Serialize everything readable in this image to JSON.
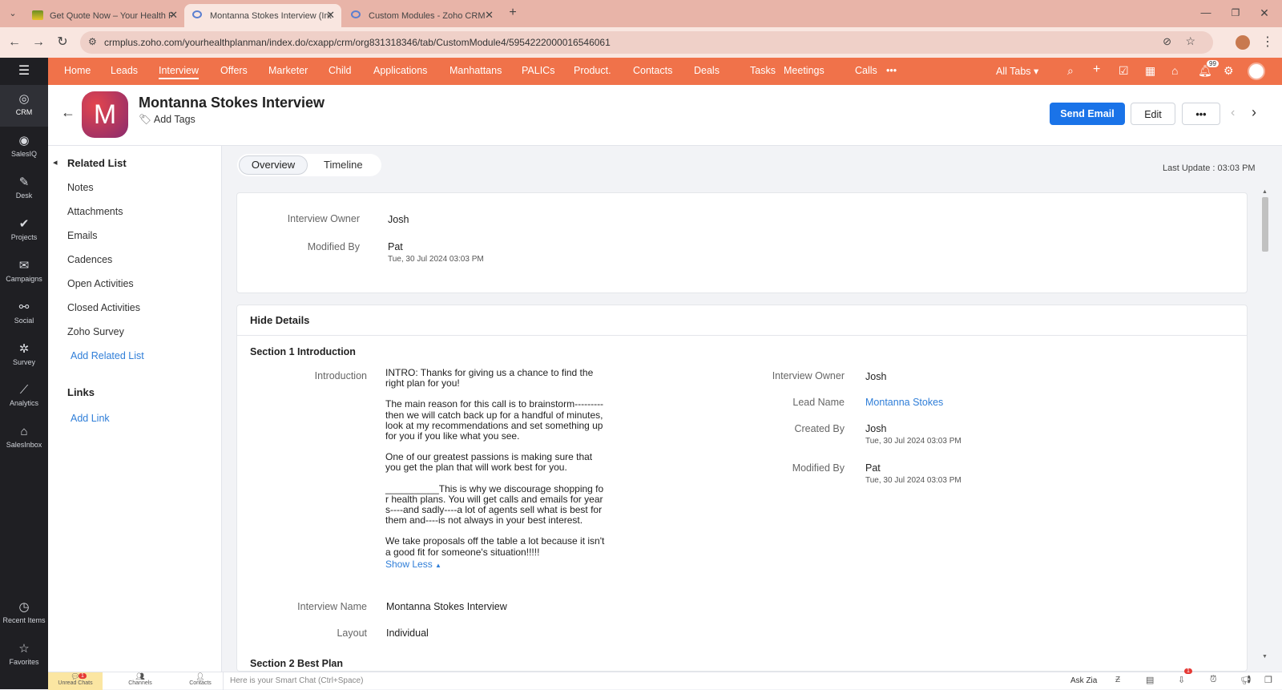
{
  "browser": {
    "tabs": [
      {
        "title": "Get Quote Now – Your Health F"
      },
      {
        "title": "Montanna Stokes Interview (Int"
      },
      {
        "title": "Custom Modules - Zoho CRM"
      }
    ],
    "url": "crmplus.zoho.com/yourhealthplanman/index.do/cxapp/crm/org831318346/tab/CustomModule4/5954222000016546061"
  },
  "rail": {
    "items": [
      {
        "label": "CRM",
        "icon": "crm-icon"
      },
      {
        "label": "SalesIQ",
        "icon": "salesiq-icon"
      },
      {
        "label": "Desk",
        "icon": "desk-icon"
      },
      {
        "label": "Projects",
        "icon": "projects-icon"
      },
      {
        "label": "Campaigns",
        "icon": "campaigns-icon"
      },
      {
        "label": "Social",
        "icon": "social-icon"
      },
      {
        "label": "Survey",
        "icon": "survey-icon"
      },
      {
        "label": "Analytics",
        "icon": "analytics-icon"
      },
      {
        "label": "SalesInbox",
        "icon": "salesinbox-icon"
      }
    ],
    "recent": "Recent Items",
    "favorites": "Favorites"
  },
  "topnav": {
    "items": [
      "Home",
      "Leads",
      "Interview",
      "Offers",
      "Marketer",
      "Child",
      "Applications",
      "Manhattans",
      "PALICs",
      "Product.",
      "Contacts",
      "Deals",
      "Tasks",
      "Meetings",
      "Calls"
    ],
    "more": "•••",
    "all_tabs": "All Tabs ▾",
    "notif_count": "99",
    "accent": "#f0724a"
  },
  "record": {
    "avatar_letter": "M",
    "title": "Montanna Stokes Interview",
    "add_tags": "Add Tags",
    "send_email": "Send Email",
    "edit": "Edit",
    "more": "•••"
  },
  "related": {
    "heading": "Related List",
    "items": [
      "Notes",
      "Attachments",
      "Emails",
      "Cadences",
      "Open Activities",
      "Closed Activities",
      "Zoho Survey"
    ],
    "add_related": "Add Related List",
    "links_heading": "Links",
    "add_link": "Add Link"
  },
  "main": {
    "tabs": [
      "Overview",
      "Timeline"
    ],
    "last_update": "Last Update : 03:03 PM",
    "summary": {
      "owner_label": "Interview Owner",
      "owner_value": "Josh",
      "modified_label": "Modified By",
      "modified_value": "Pat",
      "modified_time": "Tue, 30 Jul 2024 03:03 PM"
    },
    "details": {
      "toggle": "Hide Details",
      "section1": "Section 1 Introduction",
      "intro_label": "Introduction",
      "intro_paragraphs": [
        "INTRO: Thanks for giving us a chance to find the right plan for you!",
        "The main reason for this call is to brainstorm---------then we will catch back up for a handful of minutes, look at my recommendations and set something up for you if you like what you see.",
        "One of our greatest passions is making sure that you get the plan that will work best for you.",
        "__________This is why we discourage shopping for health plans. You will get calls and emails for years----and sadly----a lot of agents sell what is best for them and----is not always in your best interest.",
        "We take proposals off the table a lot because it isn't a good fit for someone's situation!!!!!"
      ],
      "show_less": "Show Less",
      "interview_name_label": "Interview Name",
      "interview_name_value": "Montanna Stokes Interview",
      "layout_label": "Layout",
      "layout_value": "Individual",
      "section2": "Section 2 Best Plan",
      "right": {
        "owner_label": "Interview Owner",
        "owner_value": "Josh",
        "lead_label": "Lead Name",
        "lead_value": "Montanna Stokes",
        "created_label": "Created By",
        "created_value": "Josh",
        "created_time": "Tue, 30 Jul 2024 03:03 PM",
        "modified_label": "Modified By",
        "modified_value": "Pat",
        "modified_time": "Tue, 30 Jul 2024 03:03 PM"
      }
    }
  },
  "bottombar": {
    "unread_chats": "Unread Chats",
    "unread_count": "1",
    "channels": "Channels",
    "contacts": "Contacts",
    "smart_chat_placeholder": "Here is your Smart Chat (Ctrl+Space)",
    "ask_zia": "Ask Zia",
    "notif_count": "1"
  }
}
